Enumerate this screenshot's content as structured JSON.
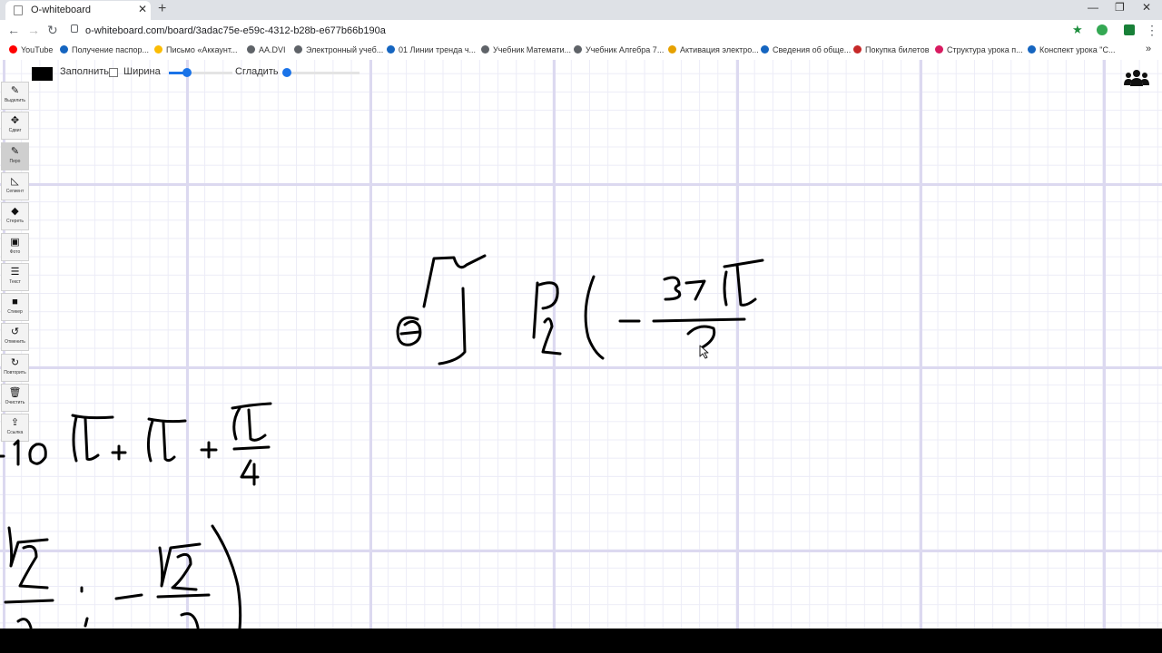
{
  "browser": {
    "tab_title": "O-whiteboard",
    "tab_close": "✕",
    "new_tab": "+",
    "url": "o-whiteboard.com/board/3adac75e-e59c-4312-b28b-e677b66b190a",
    "window_controls": {
      "minimize": "—",
      "restore": "❐",
      "close": "✕"
    },
    "nav": {
      "back": "←",
      "forward": "→",
      "reload": "↻"
    },
    "menu": "⋮",
    "bookmarks": [
      {
        "label": "YouTube",
        "color": "#ff0000"
      },
      {
        "label": "Получение паспор...",
        "color": "#1565c0"
      },
      {
        "label": "Письмо «Аккаунт...",
        "color": "#fbbc04"
      },
      {
        "label": "AA.DVI",
        "color": "#5f6368"
      },
      {
        "label": "Электронный учеб...",
        "color": "#5f6368"
      },
      {
        "label": "01 Линии тренда ч...",
        "color": "#1565c0"
      },
      {
        "label": "Учебник Математи...",
        "color": "#5f6368"
      },
      {
        "label": "Учебник Алгебра 7...",
        "color": "#5f6368"
      },
      {
        "label": "Активация электро...",
        "color": "#e6a100"
      },
      {
        "label": "Сведения об обще...",
        "color": "#1565c0"
      },
      {
        "label": "Покупка билетов",
        "color": "#c62828"
      },
      {
        "label": "Структура урока п...",
        "color": "#d81b60"
      },
      {
        "label": "Конспект урока \"С...",
        "color": "#1565c0"
      }
    ],
    "bookmarks_more": "»"
  },
  "board_controls": {
    "fill_label": "Заполнить",
    "fill_checked": false,
    "width_label": "Ширина",
    "width_value": 0.28,
    "smooth_label": "Сгладить",
    "smooth_value": 0.0,
    "current_color": "#000000"
  },
  "tools": [
    {
      "label": "Выделить",
      "icon": "✎",
      "icon_name": "select-icon",
      "active": false
    },
    {
      "label": "Сдвиг",
      "icon": "✥",
      "icon_name": "move-icon",
      "active": false
    },
    {
      "label": "Перо",
      "icon": "✎",
      "icon_name": "pen-icon",
      "active": true
    },
    {
      "label": "Сегмент",
      "icon": "◺",
      "icon_name": "segment-icon",
      "active": false
    },
    {
      "label": "Стереть",
      "icon": "◆",
      "icon_name": "eraser-icon",
      "active": false
    },
    {
      "label": "Фото",
      "icon": "▣",
      "icon_name": "photo-icon",
      "active": false
    },
    {
      "label": "Текст",
      "icon": "☰",
      "icon_name": "text-icon",
      "active": false
    },
    {
      "label": "Стикер",
      "icon": "■",
      "icon_name": "sticker-icon",
      "active": false
    },
    {
      "label": "Отменить",
      "icon": "↺",
      "icon_name": "undo-icon",
      "active": false
    },
    {
      "label": "Повторить",
      "icon": "↻",
      "icon_name": "redo-icon",
      "active": false
    },
    {
      "label": "Очистить",
      "icon": "🗑",
      "icon_name": "trash-icon",
      "active": false
    },
    {
      "label": "Ссылка",
      "icon": "⇪",
      "icon_name": "share-link-icon",
      "active": false
    }
  ],
  "users_icon": "users-icon",
  "colors": {
    "accent": "#1a73e8",
    "ink": "#000000",
    "grid_major": "#dcd9f0",
    "grid_minor": "#ececf7"
  }
}
